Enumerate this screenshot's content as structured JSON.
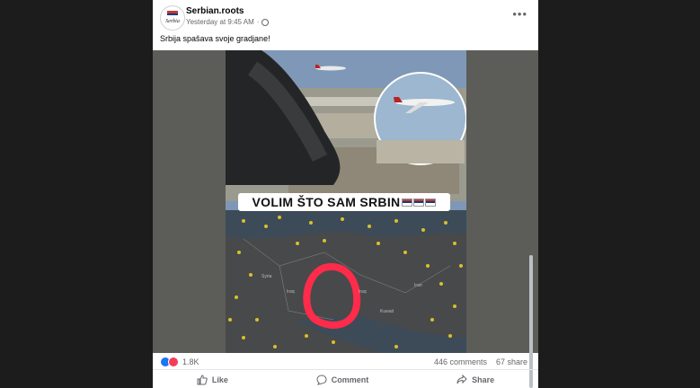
{
  "post": {
    "page_name": "Serbian.roots",
    "timestamp": "Yesterday at 9:45 AM",
    "separator": "·",
    "caption": "Srbija spašava svoje gradjane!",
    "more_label": "•••",
    "avatar_text": "Serbia"
  },
  "image": {
    "banner_text": "VOLIM ŠTO SAM SRBIN",
    "map_labels": [
      "Syria",
      "Iraq",
      "Iran",
      "Iraq",
      "Kuwait"
    ]
  },
  "engagement": {
    "reaction_count": "1.8K",
    "comments": "446 comments",
    "shares": "67 share"
  },
  "actions": {
    "like": "Like",
    "comment": "Comment",
    "share": "Share"
  },
  "colors": {
    "serbian_red": "#c6363c",
    "serbian_blue": "#0c4076",
    "facebook_blue": "#1877f2",
    "love_red": "#f33e58",
    "highlight_circle": "#ff2b4a"
  }
}
